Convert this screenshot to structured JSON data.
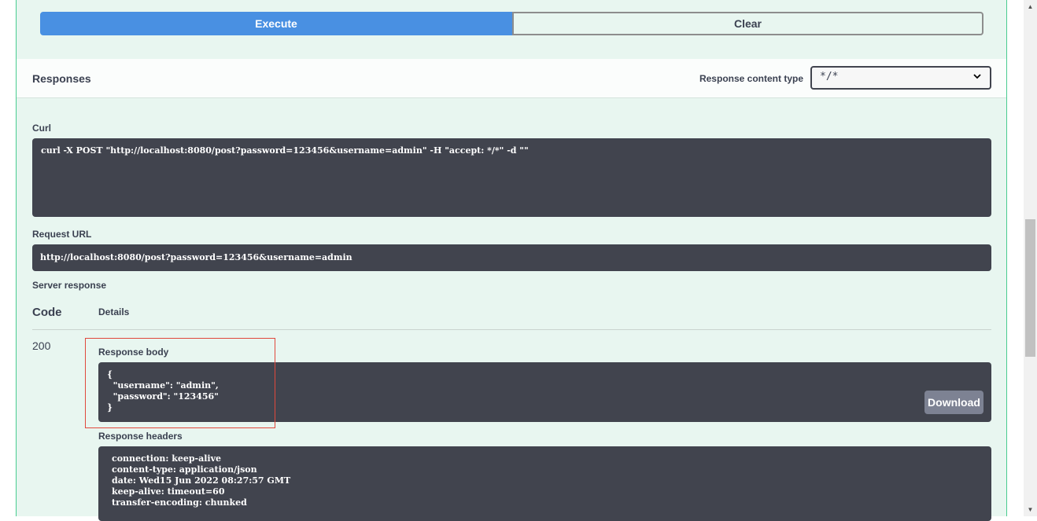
{
  "buttons": {
    "execute": "Execute",
    "clear": "Clear"
  },
  "responses": {
    "title": "Responses",
    "content_type_label": "Response content type",
    "content_type_value": "*/*"
  },
  "curl": {
    "label": "Curl",
    "command": "curl -X POST \"http://localhost:8080/post?password=123456&username=admin\" -H \"accept: */*\" -d \"\""
  },
  "request_url": {
    "label": "Request URL",
    "value": "http://localhost:8080/post?password=123456&username=admin"
  },
  "server_response": {
    "label": "Server response",
    "col_code": "Code",
    "col_details": "Details",
    "code": "200",
    "body_label": "Response body",
    "body": "{\n  \"username\": \"admin\",\n  \"password\": \"123456\"\n}",
    "download": "Download",
    "headers_label": "Response headers",
    "headers": "connection: keep-alive\ncontent-type: application/json\ndate: Wed15 Jun 2022 08:27:57 GMT\nkeep-alive: timeout=60\ntransfer-encoding: chunked"
  },
  "icons": {
    "select": "chevron-down-icon",
    "scroll_up": "scroll-up-arrow-icon",
    "scroll_down": "scroll-down-arrow-icon"
  },
  "colors": {
    "execute": "#4990e2",
    "opblock_bg": "#e8f6f0",
    "opblock_border": "#49cc90",
    "code_bg": "#41444e",
    "highlight": "#e0483c"
  }
}
